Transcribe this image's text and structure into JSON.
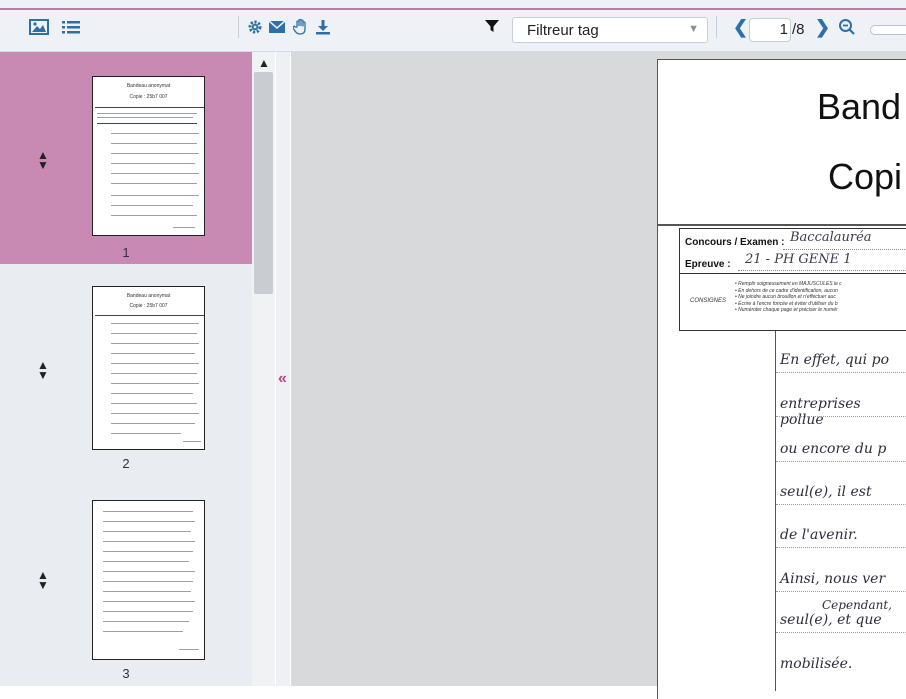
{
  "toolbar": {
    "filter_label": "Filtreur tag",
    "page_current": "1",
    "page_total": "/8",
    "accent_color": "#2e6fa8",
    "highlight_color": "#c07aa8"
  },
  "thumbnails": [
    {
      "number": "1",
      "heading1": "Bandeau anonymat",
      "heading2": "Copie : 25b7 007",
      "selected": true
    },
    {
      "number": "2",
      "heading1": "Bandeau anonymat",
      "heading2": "Copie : 25b7 007",
      "selected": false
    },
    {
      "number": "3",
      "heading1": "",
      "heading2": "",
      "selected": false
    }
  ],
  "document": {
    "title1": "Band",
    "title2": "Copi",
    "concours_label": "Concours / Examen :",
    "concours_value": "Baccalauréa",
    "epreuve_label": "Epreuve :",
    "epreuve_value": "21 - PH GENE 1",
    "consignes_label": "CONSIGNES",
    "consignes_lines": [
      "• Remplir soigneusement en MAJUSCULES le c",
      "• En dehors de ce cadre d'identification, aucun",
      "• Ne joindre aucun brouillon et n'effectuer auc",
      "• Ecrire à l'encre foncée et éviter d'utiliser du b",
      "• Numéroter chaque page et préciser le numér"
    ],
    "handwriting": [
      "En effet, qui po",
      "entreprises pollue",
      "ou encore du p",
      "seul(e), il est",
      "de l'avenir.",
      "Ainsi, nous ver",
      "Cependant,",
      "seul(e), et que",
      "mobilisée."
    ]
  }
}
